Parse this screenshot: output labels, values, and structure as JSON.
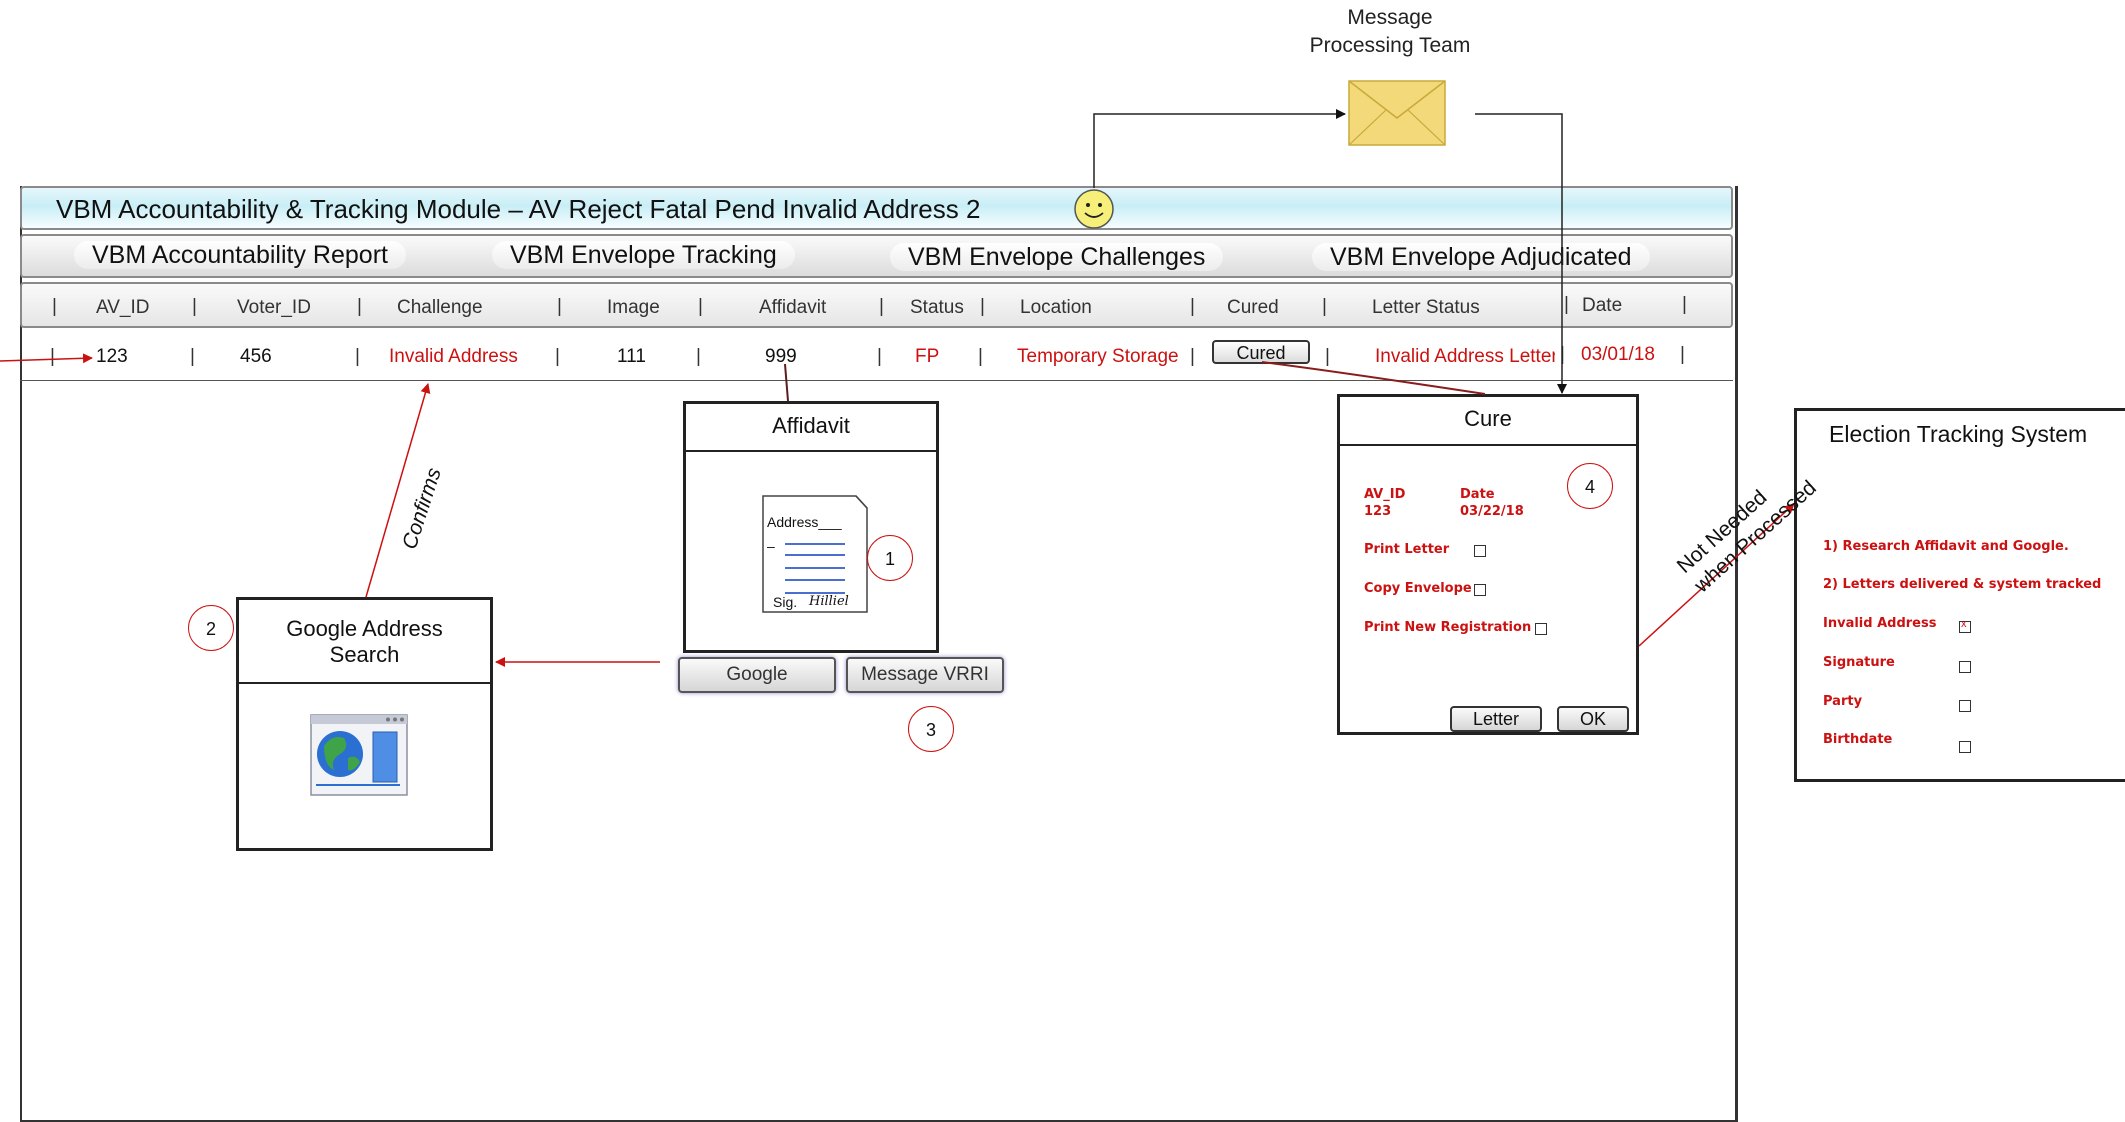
{
  "team": {
    "line1": "Message",
    "line2": "Processing Team"
  },
  "window": {
    "title": "VBM Accountability & Tracking Module – AV Reject Fatal Pend Invalid Address 2"
  },
  "tabs": [
    "VBM Accountability Report",
    "VBM Envelope Tracking",
    "VBM Envelope Challenges",
    "VBM Envelope Adjudicated"
  ],
  "table": {
    "headers": [
      "AV_ID",
      "Voter_ID",
      "Challenge",
      "Image",
      "Affidavit",
      "Status",
      "Location",
      "Cured",
      "Letter Status",
      "Date"
    ],
    "row": {
      "av_id": "123",
      "voter_id": "456",
      "challenge": "Invalid Address",
      "image": "111",
      "affidavit": "999",
      "status": "FP",
      "location": "Temporary Storage",
      "cured": "Cured",
      "letter_status": "Invalid Address Letter",
      "date": "03/01/18"
    }
  },
  "affidavit_panel": {
    "title": "Affidavit",
    "doc_address": "Address___",
    "doc_dash": "–",
    "doc_sig": "Sig.",
    "doc_signature": "Hilliel",
    "buttons": {
      "google": "Google",
      "message": "Message VRRI"
    }
  },
  "google_panel": {
    "title_line1": "Google Address",
    "title_line2": "Search"
  },
  "labels": {
    "confirms": "Confirms",
    "not_needed_1": "Not Needed",
    "not_needed_2": "when Processed"
  },
  "steps": [
    "1",
    "2",
    "3",
    "4"
  ],
  "cure_panel": {
    "title": "Cure",
    "av_id_label": "AV_ID",
    "av_id": "123",
    "date_label": "Date",
    "date": "03/22/18",
    "options": [
      "Print Letter",
      "Copy Envelope",
      "Print New Registration"
    ],
    "buttons": {
      "letter": "Letter",
      "ok": "OK"
    }
  },
  "ets_panel": {
    "title": "Election Tracking System",
    "notes": [
      "1) Research Affidavit and Google.",
      "2) Letters delivered & system tracked"
    ],
    "items": [
      {
        "label": "Invalid Address",
        "checked": true,
        "mark": "x"
      },
      {
        "label": "Signature",
        "checked": false
      },
      {
        "label": "Party",
        "checked": false
      },
      {
        "label": "Birthdate",
        "checked": false
      }
    ]
  },
  "colors": {
    "accent_red": "#cc1111",
    "title_bar": "#c9eef6",
    "envelope": "#f3d97a"
  },
  "icons": [
    "envelope-icon",
    "smiley-icon",
    "document-icon",
    "browser-globe-icon"
  ]
}
